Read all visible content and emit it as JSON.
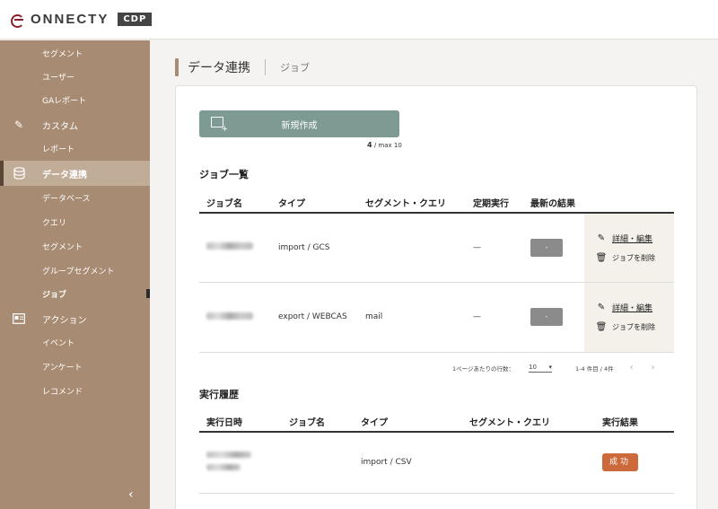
{
  "brand": {
    "name": "ONNECTY",
    "badge": "CDP"
  },
  "sidebar": {
    "items": [
      {
        "label": "セグメント",
        "type": "sub"
      },
      {
        "label": "ユーザー",
        "type": "sub"
      },
      {
        "label": "GAレポート",
        "type": "sub"
      },
      {
        "label": "カスタム",
        "type": "section",
        "icon": "pencil-icon"
      },
      {
        "label": "レポート",
        "type": "sub"
      },
      {
        "label": "データ連携",
        "type": "section",
        "icon": "database-icon",
        "active": true
      },
      {
        "label": "データベース",
        "type": "sub"
      },
      {
        "label": "クエリ",
        "type": "sub"
      },
      {
        "label": "セグメント",
        "type": "sub"
      },
      {
        "label": "グループセグメント",
        "type": "sub"
      },
      {
        "label": "ジョブ",
        "type": "sub",
        "current": true
      },
      {
        "label": "アクション",
        "type": "section",
        "icon": "action-card-icon"
      },
      {
        "label": "イベント",
        "type": "sub"
      },
      {
        "label": "アンケート",
        "type": "sub"
      },
      {
        "label": "レコメンド",
        "type": "sub"
      }
    ],
    "collapse_icon": "chevron-left-icon"
  },
  "breadcrumb": {
    "title": "データ連携",
    "sub": "ジョブ"
  },
  "new_button": {
    "label": "新規作成",
    "icon": "new-window-icon"
  },
  "job_count": {
    "current": "4",
    "max": "/ max 10"
  },
  "jobs": {
    "title": "ジョブ一覧",
    "headers": [
      "ジョブ名",
      "タイプ",
      "セグメント・クエリ",
      "定期実行",
      "最新の結果"
    ],
    "rows": [
      {
        "type": "import / GCS",
        "segment": "",
        "schedule": "—",
        "result": "-",
        "edit": "詳細・編集",
        "delete": "ジョブを削除"
      },
      {
        "type": "export / WEBCAS",
        "segment": "mail",
        "schedule": "—",
        "result": "-",
        "edit": "詳細・編集",
        "delete": "ジョブを削除"
      }
    ]
  },
  "pager": {
    "rows_label": "1ページあたりの行数：",
    "rows_value": "10",
    "range": "1-4 件目 / 4件"
  },
  "history": {
    "title": "実行履歴",
    "headers": [
      "実行日時",
      "ジョブ名",
      "タイプ",
      "セグメント・クエリ",
      "実行結果"
    ],
    "rows": [
      {
        "type": "import / CSV",
        "segment": "",
        "result": "成功"
      }
    ]
  },
  "colors": {
    "sidebar": "#a78b72",
    "accent_button": "#7d9a93",
    "success": "#cc6a3c"
  }
}
